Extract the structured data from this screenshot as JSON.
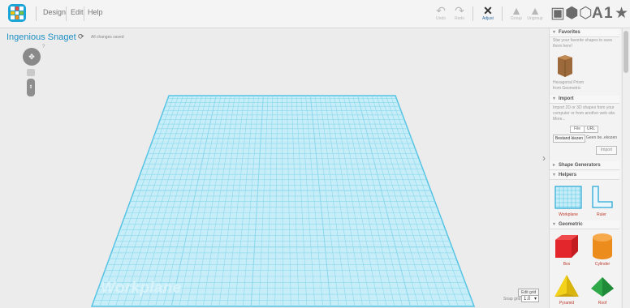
{
  "menu": {
    "items": [
      "Design",
      "Edit",
      "Help"
    ]
  },
  "toolbar": {
    "tools": [
      {
        "label": "Undo",
        "icon": "undo-icon",
        "glyph": "↶",
        "active": false
      },
      {
        "label": "Redo",
        "icon": "redo-icon",
        "glyph": "↷",
        "active": false
      },
      {
        "label": "Adjust",
        "icon": "adjust-icon",
        "glyph": "✕",
        "active": true
      },
      {
        "label": "Group",
        "icon": "group-icon",
        "glyph": "▲",
        "active": false
      },
      {
        "label": "Ungroup",
        "icon": "ungroup-icon",
        "glyph": "▲",
        "active": false
      }
    ],
    "view_icons": [
      {
        "name": "notebook-icon",
        "glyph": "▣"
      },
      {
        "name": "solid-shape-icon",
        "glyph": "⬢"
      },
      {
        "name": "outline-shape-icon",
        "glyph": "⬡"
      },
      {
        "name": "text-icon",
        "glyph": "A"
      },
      {
        "name": "number-icon",
        "glyph": "1"
      },
      {
        "name": "favorites-star-icon",
        "glyph": "★"
      }
    ]
  },
  "design": {
    "title": "Ingenious Snaget",
    "save_status": "All changes saved"
  },
  "viewport": {
    "help_label": "?",
    "workplane_label": "Workplane",
    "edit_grid_label": "Edit grid",
    "snap_grid_label": "Snap grid",
    "snap_grid_value": "1.0"
  },
  "panel": {
    "favorites": {
      "header": "Favorites",
      "description": "Star your favorite shapes to save them here!",
      "shape_caption": "Hexagonal Prism from Geometric"
    },
    "import": {
      "header": "Import",
      "description": "Import 2D or 3D shapes from your computer or from another web site. More...",
      "tabs": [
        "File",
        "URL"
      ],
      "choose_file_label": "Bestand kiezen",
      "no_file_label": "Geen be..ekozen",
      "import_button": "Import"
    },
    "shape_generators": {
      "header": "Shape Generators"
    },
    "helpers": {
      "header": "Helpers",
      "items": [
        "Workplane",
        "Ruler"
      ]
    },
    "geometric": {
      "header": "Geometric",
      "items": [
        "Box",
        "Cylinder",
        "Pyramid",
        "Roof"
      ]
    }
  },
  "colors": {
    "accent": "#1aa5d8",
    "grid_fill": "#c7eef8",
    "grid_line": "#7fd3ea",
    "box_red": "#e3262b",
    "cylinder_orange": "#ec8c1c",
    "pyramid_yellow": "#f3d21c",
    "roof_green": "#2fa84a",
    "hex_brown": "#9c6a3a"
  }
}
